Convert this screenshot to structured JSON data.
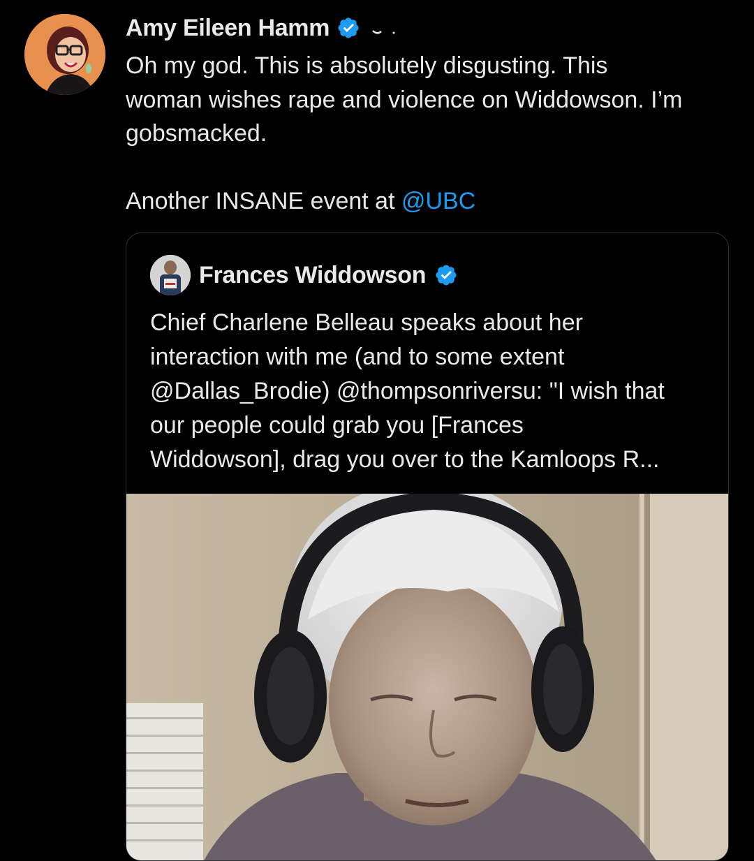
{
  "post": {
    "author_name": "Amy Eileen Hamm",
    "avatar_icon": "user-avatar-icon",
    "verified_icon": "verified-badge-icon",
    "badge_color": "#1d9bf0",
    "text_lines": [
      "Oh my god. This is absolutely disgusting. This",
      "woman wishes rape and violence on Widdowson. I’m",
      "gobsmacked."
    ],
    "text_tail_prefix": "Another INSANE event at ",
    "text_tail_mention": "@UBC",
    "mention_color": "#1d9bf0"
  },
  "quote": {
    "author_name": "Frances Widdowson",
    "avatar_icon": "quote-user-avatar-icon",
    "verified_icon": "verified-badge-icon",
    "text_lines": [
      "Chief Charlene Belleau speaks about her",
      "interaction with me (and to some extent",
      "@Dallas_Brodie) @thompsonriversu: \"I wish that",
      "our people could grab you [Frances",
      "Widdowson], drag you over to the Kamloops R..."
    ],
    "media": {
      "type": "video-thumbnail",
      "icon": "video-thumbnail-image"
    }
  }
}
